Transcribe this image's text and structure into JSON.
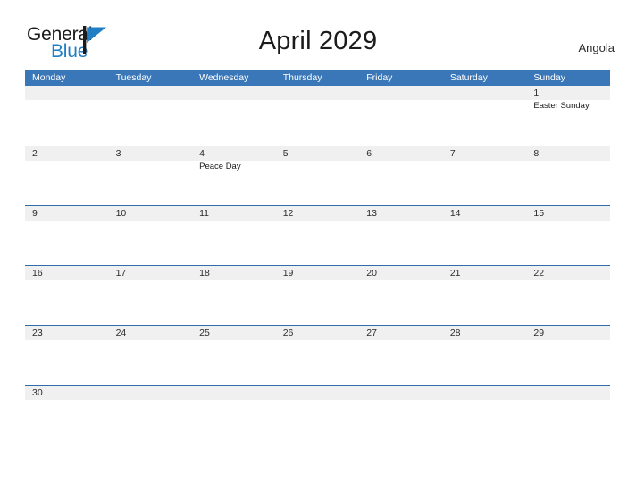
{
  "brand": {
    "name_part1": "General",
    "name_part2": "Blue",
    "flag_icon": "blue-triangle-flag-icon",
    "accent_color": "#1f7ec4"
  },
  "header": {
    "title": "April 2029",
    "country": "Angola"
  },
  "theme": {
    "header_blue": "#3a77b8",
    "row_divider_blue": "#2e6da8",
    "date_band_gray": "#f0f0f0",
    "text_dark": "#2b2b2b"
  },
  "calendar": {
    "month": "April",
    "year": "2029",
    "weekday_headers": [
      "Monday",
      "Tuesday",
      "Wednesday",
      "Thursday",
      "Friday",
      "Saturday",
      "Sunday"
    ],
    "weeks": [
      {
        "days": [
          {
            "num": "",
            "events": []
          },
          {
            "num": "",
            "events": []
          },
          {
            "num": "",
            "events": []
          },
          {
            "num": "",
            "events": []
          },
          {
            "num": "",
            "events": []
          },
          {
            "num": "",
            "events": []
          },
          {
            "num": "1",
            "events": [
              "Easter Sunday"
            ]
          }
        ]
      },
      {
        "days": [
          {
            "num": "2",
            "events": []
          },
          {
            "num": "3",
            "events": []
          },
          {
            "num": "4",
            "events": [
              "Peace Day"
            ]
          },
          {
            "num": "5",
            "events": []
          },
          {
            "num": "6",
            "events": []
          },
          {
            "num": "7",
            "events": []
          },
          {
            "num": "8",
            "events": []
          }
        ]
      },
      {
        "days": [
          {
            "num": "9",
            "events": []
          },
          {
            "num": "10",
            "events": []
          },
          {
            "num": "11",
            "events": []
          },
          {
            "num": "12",
            "events": []
          },
          {
            "num": "13",
            "events": []
          },
          {
            "num": "14",
            "events": []
          },
          {
            "num": "15",
            "events": []
          }
        ]
      },
      {
        "days": [
          {
            "num": "16",
            "events": []
          },
          {
            "num": "17",
            "events": []
          },
          {
            "num": "18",
            "events": []
          },
          {
            "num": "19",
            "events": []
          },
          {
            "num": "20",
            "events": []
          },
          {
            "num": "21",
            "events": []
          },
          {
            "num": "22",
            "events": []
          }
        ]
      },
      {
        "days": [
          {
            "num": "23",
            "events": []
          },
          {
            "num": "24",
            "events": []
          },
          {
            "num": "25",
            "events": []
          },
          {
            "num": "26",
            "events": []
          },
          {
            "num": "27",
            "events": []
          },
          {
            "num": "28",
            "events": []
          },
          {
            "num": "29",
            "events": []
          }
        ]
      },
      {
        "days": [
          {
            "num": "30",
            "events": []
          },
          {
            "num": "",
            "events": []
          },
          {
            "num": "",
            "events": []
          },
          {
            "num": "",
            "events": []
          },
          {
            "num": "",
            "events": []
          },
          {
            "num": "",
            "events": []
          },
          {
            "num": "",
            "events": []
          }
        ]
      }
    ]
  }
}
